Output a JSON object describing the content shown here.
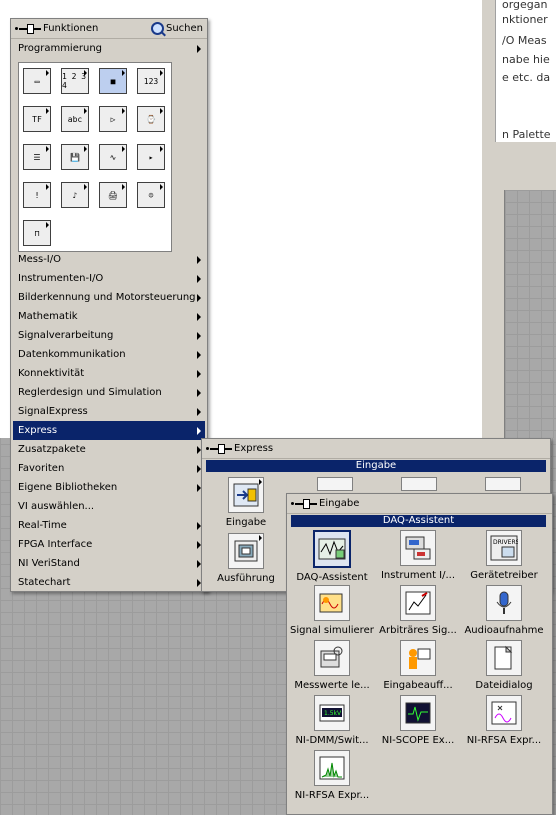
{
  "background": {
    "doc_lines": [
      "orgegan",
      "nktioner",
      "/O Meas",
      "nabe hie",
      "e etc. da",
      "",
      "n Palette"
    ]
  },
  "functions_palette": {
    "title": "Funktionen",
    "search_label": "Suchen",
    "items": [
      {
        "label": "Programmierung",
        "selected": false
      },
      {
        "label": "Mess-I/O",
        "selected": false
      },
      {
        "label": "Instrumenten-I/O",
        "selected": false
      },
      {
        "label": "Bilderkennung und Motorsteuerung",
        "selected": false
      },
      {
        "label": "Mathematik",
        "selected": false
      },
      {
        "label": "Signalverarbeitung",
        "selected": false
      },
      {
        "label": "Datenkommunikation",
        "selected": false
      },
      {
        "label": "Konnektivität",
        "selected": false
      },
      {
        "label": "Reglerdesign und Simulation",
        "selected": false
      },
      {
        "label": "SignalExpress",
        "selected": false
      },
      {
        "label": "Express",
        "selected": true
      },
      {
        "label": "Zusatzpakete",
        "selected": false
      },
      {
        "label": "Favoriten",
        "selected": false
      },
      {
        "label": "Eigene Bibliotheken",
        "selected": false
      },
      {
        "label": "VI auswählen...",
        "selected": false
      },
      {
        "label": "Real-Time",
        "selected": false
      },
      {
        "label": "FPGA Interface",
        "selected": false
      },
      {
        "label": "NI VeriStand",
        "selected": false
      },
      {
        "label": "Statechart",
        "selected": false
      }
    ],
    "programming_icons": [
      {
        "icon": "structures-icon",
        "glyph": "▭"
      },
      {
        "icon": "array-icon",
        "glyph": "1 2\n3 4"
      },
      {
        "icon": "cluster-icon",
        "glyph": "■"
      },
      {
        "icon": "numeric-icon",
        "glyph": "123"
      },
      {
        "icon": "boolean-icon",
        "glyph": "TF"
      },
      {
        "icon": "string-icon",
        "glyph": "abc"
      },
      {
        "icon": "comparison-icon",
        "glyph": "▷"
      },
      {
        "icon": "timing-icon",
        "glyph": "⌚"
      },
      {
        "icon": "dialog-icon",
        "glyph": "☰"
      },
      {
        "icon": "file-io-icon",
        "glyph": "💾"
      },
      {
        "icon": "waveform-icon",
        "glyph": "∿"
      },
      {
        "icon": "app-control-icon",
        "glyph": "▸"
      },
      {
        "icon": "synchronization-icon",
        "glyph": "!"
      },
      {
        "icon": "graphics-sound-icon",
        "glyph": "♪"
      },
      {
        "icon": "report-icon",
        "glyph": "🖨"
      },
      {
        "icon": "robot-icon",
        "glyph": "☺"
      },
      {
        "icon": "instrument-icon",
        "glyph": "⊓"
      }
    ]
  },
  "express_palette": {
    "title": "Express",
    "section": "Eingabe",
    "items": [
      {
        "label": "Eingabe",
        "icon": "eingabe-icon"
      },
      {
        "label": "Ausführung",
        "icon": "ausfuehrung-icon"
      }
    ]
  },
  "eingabe_palette": {
    "title": "Eingabe",
    "section": "DAQ-Assistent",
    "items": [
      {
        "label": "DAQ-Assistent",
        "icon": "daq-assistant-icon",
        "selected": true
      },
      {
        "label": "Instrument I/...",
        "icon": "instrument-io-icon",
        "selected": false
      },
      {
        "label": "Gerätetreiber",
        "icon": "drivers-icon",
        "selected": false
      },
      {
        "label": "Signal simulieren",
        "icon": "simulate-signal-icon",
        "selected": false
      },
      {
        "label": "Arbiträres Sig...",
        "icon": "arbitrary-signal-icon",
        "selected": false
      },
      {
        "label": "Audioaufnahme",
        "icon": "microphone-icon",
        "selected": false
      },
      {
        "label": "Messwerte le...",
        "icon": "read-measurement-icon",
        "selected": false
      },
      {
        "label": "Eingabeauff...",
        "icon": "prompt-user-icon",
        "selected": false
      },
      {
        "label": "Dateidialog",
        "icon": "file-dialog-icon",
        "selected": false
      },
      {
        "label": "NI-DMM/Swit...",
        "icon": "dmm-icon",
        "selected": false
      },
      {
        "label": "NI-SCOPE Ex...",
        "icon": "scope-icon",
        "selected": false
      },
      {
        "label": "NI-RFSA Expr...",
        "icon": "rfsa-icon",
        "selected": false
      },
      {
        "label": "NI-RFSA Expr...",
        "icon": "rfsa-spectrum-icon",
        "selected": false
      }
    ],
    "dmm_text": "1.5kV",
    "drivers_text": "DRIVERS"
  }
}
